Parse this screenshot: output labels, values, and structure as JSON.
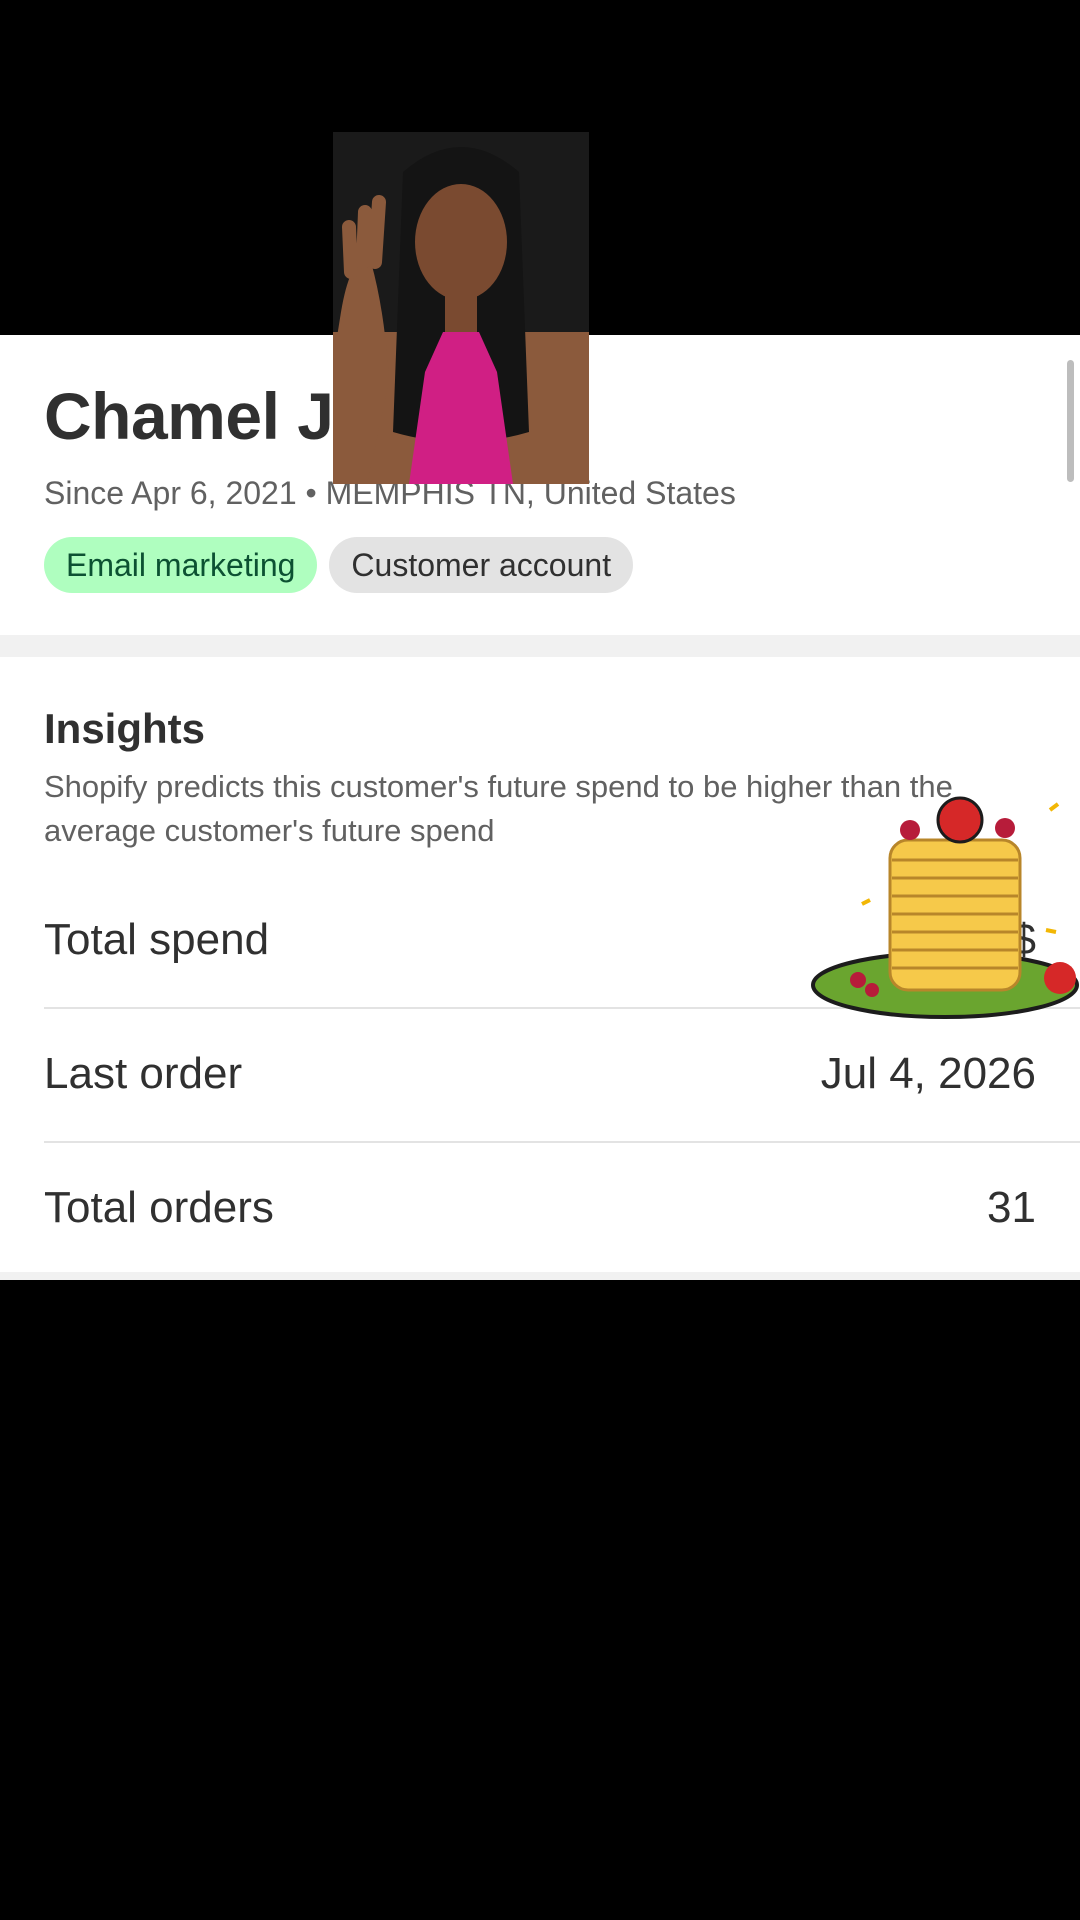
{
  "customer": {
    "name": "Chamel J",
    "meta": "Since Apr 6, 2021 • MEMPHIS TN, United States",
    "badges": [
      "Email marketing",
      "Customer account"
    ]
  },
  "insights": {
    "title": "Insights",
    "description": "Shopify predicts this customer's future spend to be higher than the average customer's future spend",
    "rows": [
      {
        "label": "Total spend",
        "value": "$"
      },
      {
        "label": "Last order",
        "value": "Jul 4, 2026"
      },
      {
        "label": "Total orders",
        "value": "31"
      }
    ]
  },
  "colors": {
    "green_badge": "#affebf",
    "grey_badge": "#e3e3e3",
    "background": "#000000"
  },
  "overlays": {
    "video_person": "person-video-overlay",
    "sticker": "pancake-stack-icon"
  }
}
